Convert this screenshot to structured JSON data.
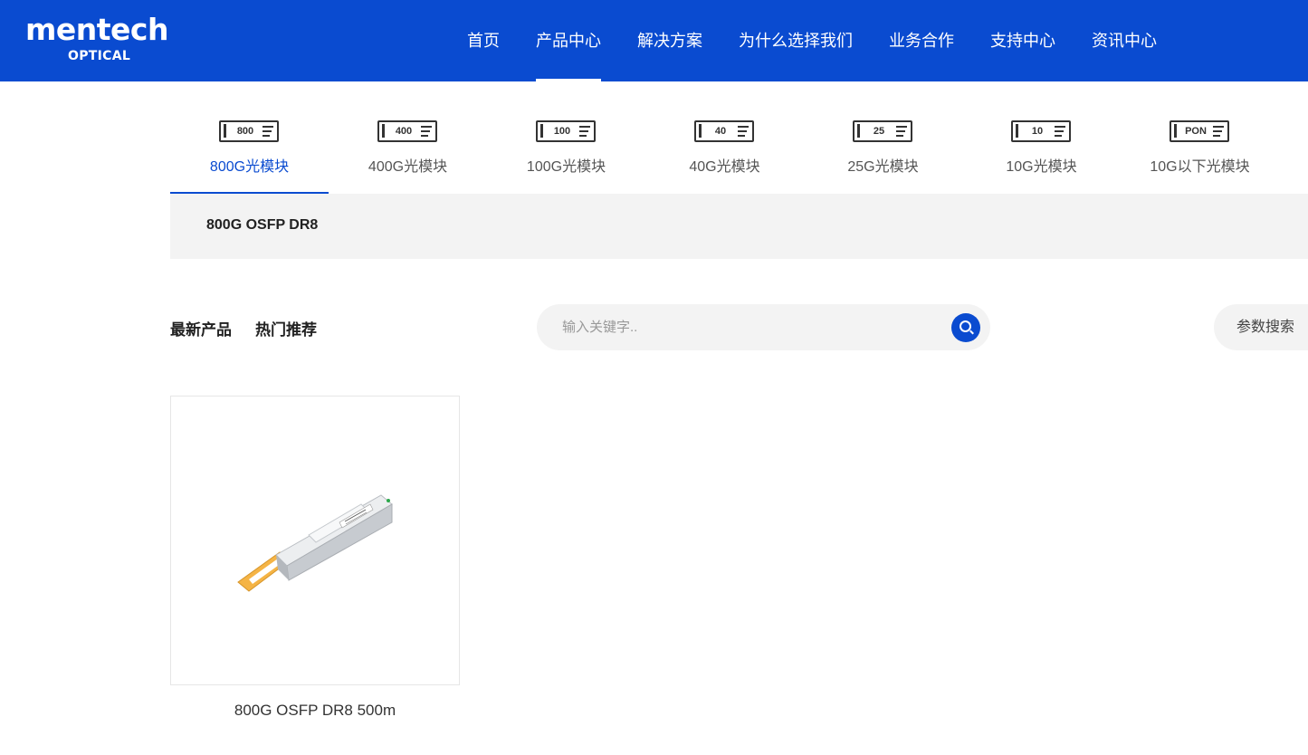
{
  "header": {
    "logo_main": "mentech",
    "logo_sub": "OPTICAL",
    "nav": [
      {
        "label": "首页"
      },
      {
        "label": "产品中心",
        "active": true
      },
      {
        "label": "解决方案"
      },
      {
        "label": "为什么选择我们"
      },
      {
        "label": "业务合作"
      },
      {
        "label": "支持中心"
      },
      {
        "label": "资讯中心"
      }
    ]
  },
  "categories": [
    {
      "icon_code": "800",
      "label": "800G光模块",
      "active": true
    },
    {
      "icon_code": "400",
      "label": "400G光模块"
    },
    {
      "icon_code": "100",
      "label": "100G光模块"
    },
    {
      "icon_code": "40",
      "label": "40G光模块"
    },
    {
      "icon_code": "25",
      "label": "25G光模块"
    },
    {
      "icon_code": "10",
      "label": "10G光模块"
    },
    {
      "icon_code": "PON",
      "label": "10G以下光模块"
    }
  ],
  "subcategory": {
    "label": "800G OSFP DR8"
  },
  "filters": {
    "newest": "最新产品",
    "hot": "热门推荐",
    "search_placeholder": "输入关键字..",
    "param_search": "参数搜索"
  },
  "products": [
    {
      "name": "800G OSFP DR8 500m",
      "label_text": "800G OSFP DR8"
    }
  ],
  "colors": {
    "brand_blue": "#0a4bd0",
    "panel_gray": "#f3f3f3",
    "handle_orange": "#f5b445"
  }
}
